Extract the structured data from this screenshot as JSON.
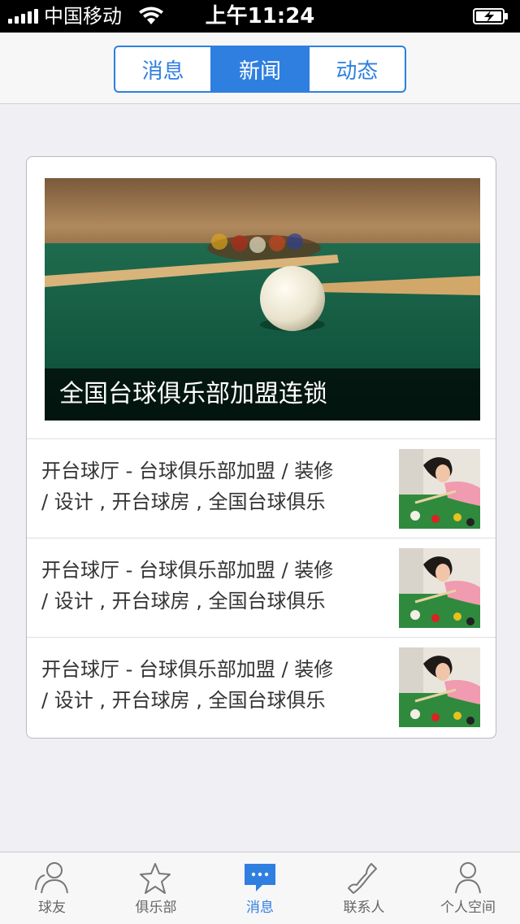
{
  "status_bar": {
    "carrier": "中国移动",
    "time": "上午11:24"
  },
  "segments": [
    {
      "label": "消息",
      "active": false
    },
    {
      "label": "新闻",
      "active": true
    },
    {
      "label": "动态",
      "active": false
    }
  ],
  "featured": {
    "caption": "全国台球俱乐部加盟连锁"
  },
  "news": [
    {
      "line1": "开台球厅 - 台球俱乐部加盟 / 装修",
      "line2": "/ 设计 , 开台球房 , 全国台球俱乐"
    },
    {
      "line1": "开台球厅 - 台球俱乐部加盟 / 装修",
      "line2": "/ 设计 , 开台球房 , 全国台球俱乐"
    },
    {
      "line1": "开台球厅 - 台球俱乐部加盟 / 装修",
      "line2": "/ 设计 , 开台球房 , 全国台球俱乐"
    }
  ],
  "tabs": [
    {
      "label": "球友",
      "icon": "friends-icon"
    },
    {
      "label": "俱乐部",
      "icon": "club-star-icon"
    },
    {
      "label": "消息",
      "icon": "chat-bubble-icon",
      "active": true
    },
    {
      "label": "联系人",
      "icon": "phone-icon"
    },
    {
      "label": "个人空间",
      "icon": "person-icon"
    }
  ],
  "colors": {
    "accent": "#2f7fe0",
    "background": "#efeff4",
    "felt": "#0e6b4f"
  }
}
